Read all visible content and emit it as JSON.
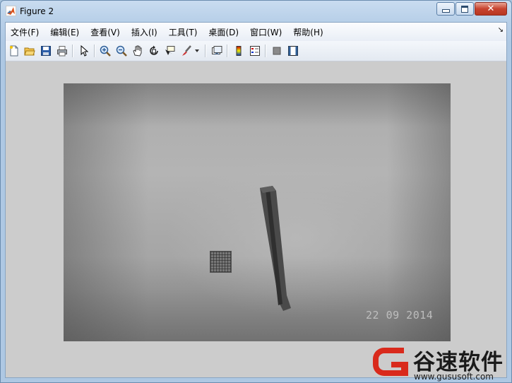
{
  "window": {
    "title": "Figure 2",
    "icon": "matlab-logo-icon",
    "controls": {
      "minimize_icon": "minimize-icon",
      "maximize_icon": "maximize-icon",
      "close_icon": "close-icon",
      "close_glyph": "✕"
    }
  },
  "menubar": {
    "items": [
      {
        "label": "文件(F)"
      },
      {
        "label": "编辑(E)"
      },
      {
        "label": "查看(V)"
      },
      {
        "label": "插入(I)"
      },
      {
        "label": "工具(T)"
      },
      {
        "label": "桌面(D)"
      },
      {
        "label": "窗口(W)"
      },
      {
        "label": "帮助(H)"
      }
    ],
    "dock_arrow": "↘"
  },
  "toolbar": {
    "buttons": [
      "new-figure-icon",
      "open-file-icon",
      "save-icon",
      "print-icon",
      "edit-plot-pointer-icon",
      "zoom-in-icon",
      "zoom-out-icon",
      "pan-hand-icon",
      "rotate-3d-icon",
      "data-cursor-icon",
      "brush-icon",
      "brush-dropdown-icon",
      "link-plot-icon",
      "insert-colorbar-icon",
      "insert-legend-icon",
      "hide-plot-tools-icon",
      "show-plot-tools-icon"
    ]
  },
  "figure": {
    "background": "#cccccc",
    "image_timestamp": "22 09 2014"
  },
  "watermark": {
    "brand": "谷速软件",
    "url": "www.gususoft.com",
    "logo_color": "#d92a1c"
  }
}
